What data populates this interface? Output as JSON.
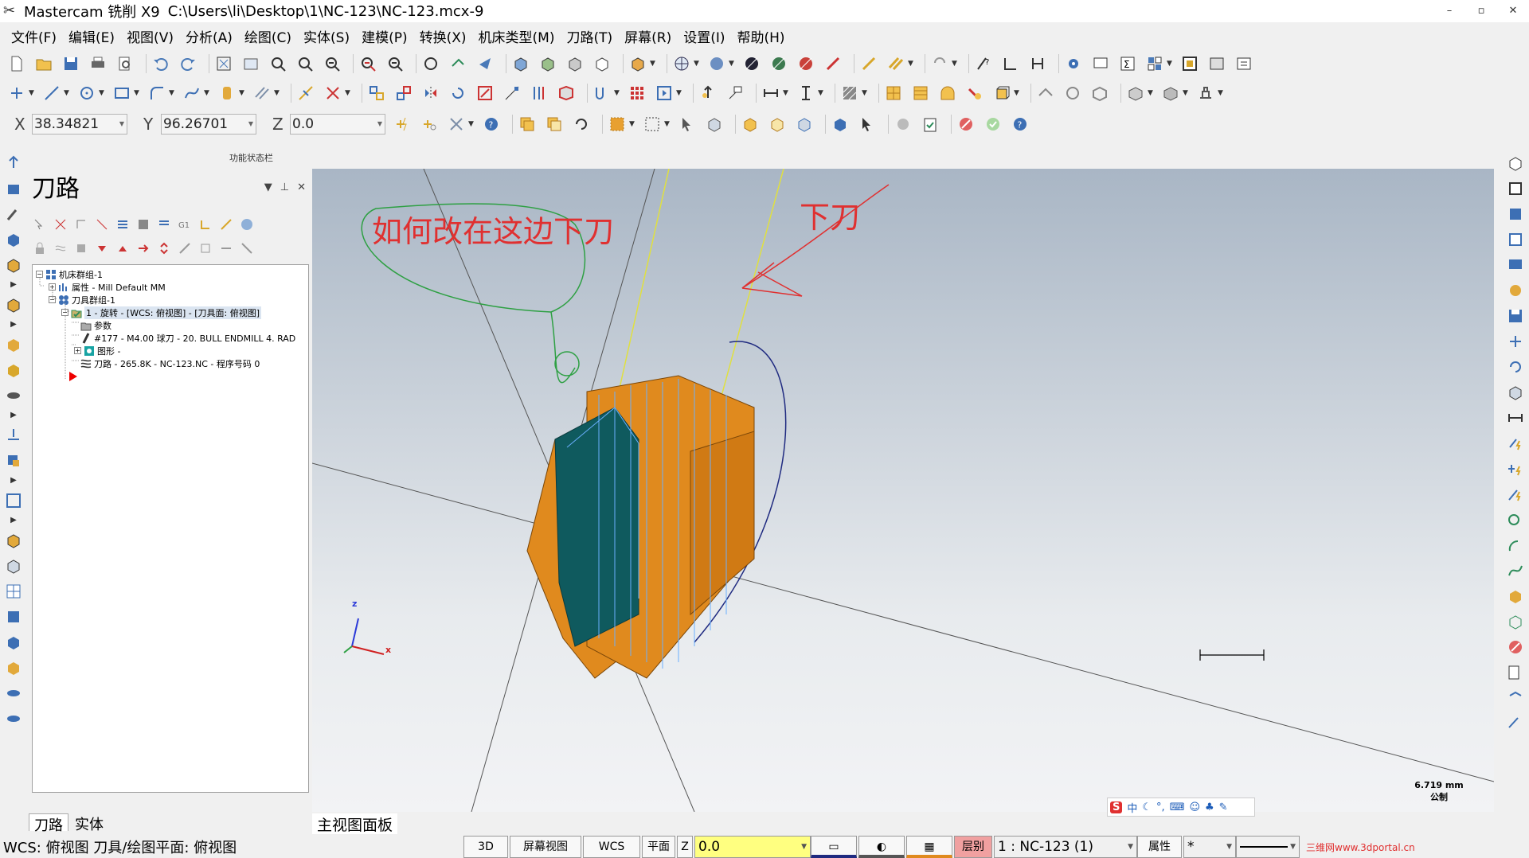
{
  "window": {
    "app_name": "Mastercam 铣削 X9",
    "file_path": "C:\\Users\\li\\Desktop\\1\\NC-123\\NC-123.mcx-9",
    "minimize": "–",
    "restore": "▫",
    "close": "✕"
  },
  "menu": [
    "文件(F)",
    "编辑(E)",
    "视图(V)",
    "分析(A)",
    "绘图(C)",
    "实体(S)",
    "建模(P)",
    "转换(X)",
    "机床类型(M)",
    "刀路(T)",
    "屏幕(R)",
    "设置(I)",
    "帮助(H)"
  ],
  "coords": {
    "x_label": "X",
    "x_value": "38.34821",
    "y_label": "Y",
    "y_value": "96.26701",
    "z_label": "Z",
    "z_value": "0.0"
  },
  "status_bar_label": "功能状态栏",
  "panel": {
    "title": "刀路",
    "tree": {
      "machine_group": "机床群组-1",
      "properties": "属性 - Mill Default MM",
      "toolpath_group": "刀具群组-1",
      "operation": "1 - 旋转 - [WCS: 俯视图] - [刀具面: 俯视图]",
      "params": "参数",
      "tool": "#177 - M4.00 球刀 -    20. BULL ENDMILL 4. RAD",
      "geometry": "图形 -",
      "toolpath": "刀路 - 265.8K - NC-123.NC - 程序号码 0"
    },
    "tabs": [
      "刀路",
      "实体"
    ]
  },
  "viewport": {
    "annotation_main": "如何改在这边下刀",
    "annotation_arrow": "下刀",
    "axis_x": "x",
    "axis_z": "z",
    "scale_value": "6.719 mm",
    "scale_unit": "公制",
    "tab_label": "主视图面板"
  },
  "ime": {
    "logo": "S",
    "lang": "中"
  },
  "statusbar": {
    "wcs": "WCS: 俯视图  刀具/绘图平面: 俯视图",
    "btn_3d": "3D",
    "btn_screen_view": "屏幕视图",
    "btn_wcs": "WCS",
    "btn_plane": "平面",
    "z_label": "Z",
    "z_value": "0.0",
    "btn_level": "层别",
    "level_value": "1 : NC-123 (1)",
    "btn_attr": "属性",
    "attr_value": "*"
  },
  "watermark": "三维网www.3dportal.cn",
  "colors": {
    "viewport_top": "#a9b6c5",
    "part_orange": "#e08a1e",
    "part_teal": "#0f5a5e",
    "annotation_red": "#e03030",
    "annotation_green": "#2ea043",
    "tool_line": "#e0e040"
  }
}
